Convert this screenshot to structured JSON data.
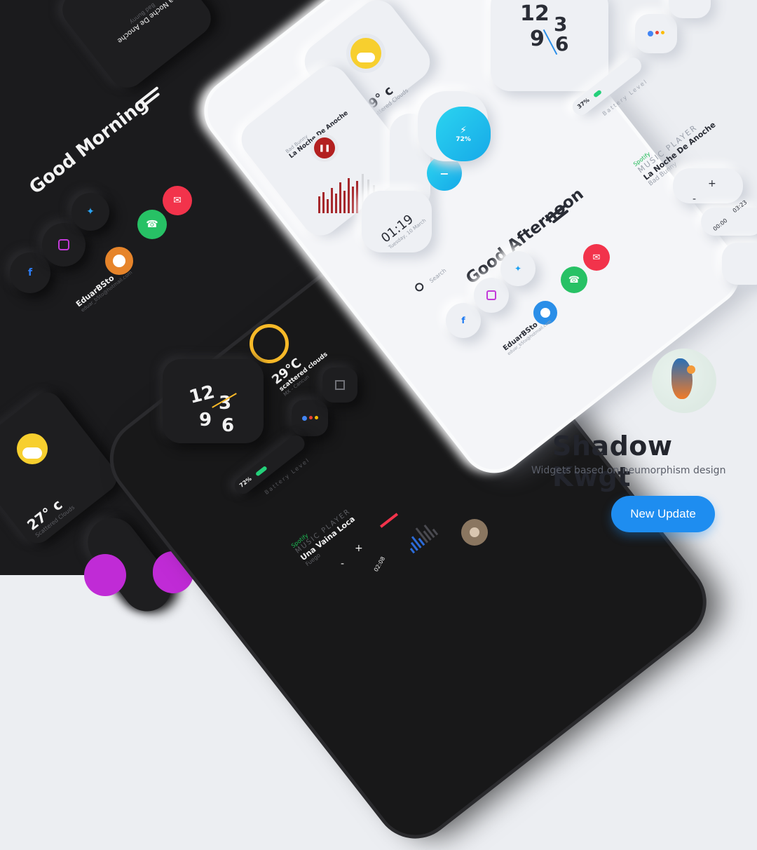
{
  "brand": {
    "title": "Shadow Kwgt",
    "subtitle": "Widgets based on neumorphism design",
    "cta_label": "New Update",
    "accent": "#1e8df0"
  },
  "light_phone": {
    "greeting": "Good Afternoon",
    "search_placeholder": "Search",
    "weather": {
      "temp": "29° c",
      "desc": "Scattered Clouds"
    },
    "music": {
      "artist": "Bad Bunny",
      "title": "La Noche De Anoche"
    },
    "volume_percent": "72%",
    "clock": {
      "time": "01:19",
      "date": "Tuesday, 10 March"
    },
    "profile": {
      "name": "EduarBSto",
      "email": "eduar_b5to@hotmail.com"
    },
    "icons": [
      "facebook-icon",
      "instagram-icon",
      "twitter-icon",
      "phone-icon",
      "mail-icon"
    ]
  },
  "light_widgets": {
    "clock_digits": [
      "12",
      "9",
      "3",
      "6"
    ],
    "battery_percent": "37%",
    "battery_label": "Battery Level",
    "spotify_label": "Spotify",
    "player_label": "MUSIC PLAYER",
    "song_title": "La Noche De Anoche",
    "song_artist": "Bad Bunny",
    "minus": "-",
    "plus": "+",
    "time_start": "00:00",
    "time_end": "03:23"
  },
  "dark_top": {
    "greeting": "Good Morning",
    "profile": {
      "name": "EduarBSto",
      "email": "eduar_b5to@hotmail.com"
    },
    "corner_text": "La Noche De Anoche",
    "corner_artist": "Bad Bunny"
  },
  "dark_phone": {
    "weather": {
      "temp": "29°C",
      "desc": "scattered clouds",
      "location": "MX - Cancun"
    },
    "clock_digits": [
      "12",
      "9",
      "3",
      "6"
    ],
    "battery_percent": "72%",
    "battery_label": "Battery Level",
    "spotify_label": "Spotify",
    "player_label": "MUSIC PLAYER",
    "song_title": "Una Vaina Loca",
    "song_artist": "Fuego",
    "minus": "-",
    "plus": "+",
    "time_elapsed": "02:08"
  },
  "dark_left": {
    "temp": "27° c",
    "desc": "Scattered Clouds"
  }
}
